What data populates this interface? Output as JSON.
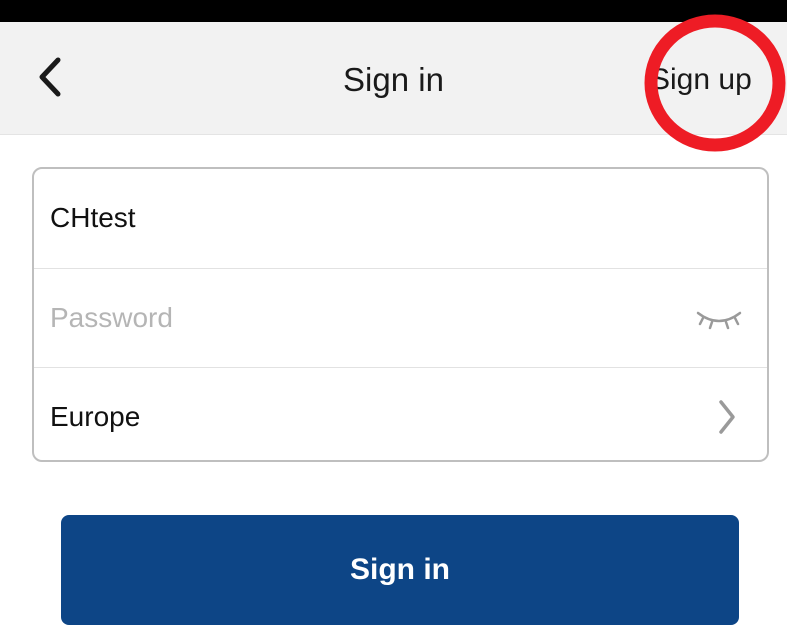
{
  "status_bar": {
    "color": "#000000"
  },
  "nav": {
    "title": "Sign in",
    "back_icon": "chevron-left-icon",
    "signup_label": "Sign up",
    "background": "#f2f2f2"
  },
  "annotation": {
    "circle_color": "#ee1c25",
    "target": "signup-button"
  },
  "form": {
    "username": {
      "value": "CHtest"
    },
    "password": {
      "placeholder": "Password",
      "value": "",
      "icon": "eye-closed-icon"
    },
    "region": {
      "value": "Europe",
      "icon": "chevron-right-icon"
    }
  },
  "submit": {
    "label": "Sign in",
    "color": "#0d4586"
  }
}
